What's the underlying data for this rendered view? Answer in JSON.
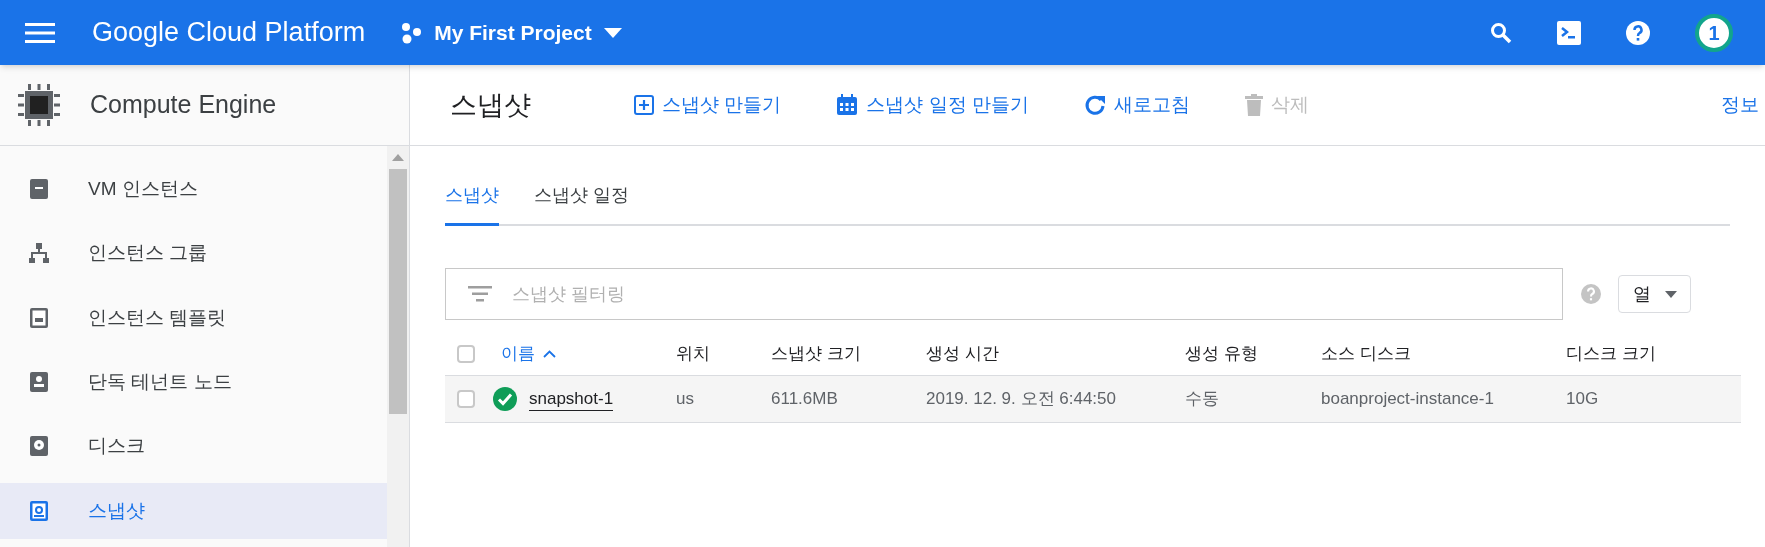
{
  "topbar": {
    "title": "Google Cloud Platform",
    "project": "My First Project",
    "avatar": "1"
  },
  "sidebar": {
    "product": "Compute Engine",
    "items": [
      {
        "label": "VM 인스턴스",
        "kind": "vm",
        "selected": false
      },
      {
        "label": "인스턴스 그룹",
        "kind": "group",
        "selected": false
      },
      {
        "label": "인스턴스 템플릿",
        "kind": "template",
        "selected": false
      },
      {
        "label": "단독 테넌트 노드",
        "kind": "node",
        "selected": false
      },
      {
        "label": "디스크",
        "kind": "disk",
        "selected": false
      },
      {
        "label": "스냅샷",
        "kind": "snapshot",
        "selected": true
      }
    ]
  },
  "page": {
    "title": "스냅샷",
    "actions": [
      {
        "label": "스냅샷 만들기",
        "kind": "create",
        "disabled": false
      },
      {
        "label": "스냅샷 일정 만들기",
        "kind": "schedule",
        "disabled": false
      },
      {
        "label": "새로고침",
        "kind": "refresh",
        "disabled": false
      },
      {
        "label": "삭제",
        "kind": "delete",
        "disabled": true
      }
    ],
    "info": "정보"
  },
  "tabs": [
    {
      "label": "스냅샷",
      "selected": true
    },
    {
      "label": "스냅샷 일정",
      "selected": false
    }
  ],
  "filter": {
    "placeholder": "스냅샷 필터링"
  },
  "columns_button": "열",
  "table": {
    "select_all": {
      "checked": false
    },
    "columns": [
      {
        "label": "이름",
        "sorted": true
      },
      {
        "label": "위치",
        "sorted": false
      },
      {
        "label": "스냅샷 크기",
        "sorted": false
      },
      {
        "label": "생성 시간",
        "sorted": false
      },
      {
        "label": "생성 유형",
        "sorted": false
      },
      {
        "label": "소스 디스크",
        "sorted": false
      },
      {
        "label": "디스크 크기",
        "sorted": false
      }
    ],
    "rows": [
      {
        "checked": false,
        "succeeded": true,
        "cells": [
          "snapshot-1",
          "us",
          "611.6MB",
          "2019. 12. 9. 오전 6:44:50",
          "수동",
          "boanproject-instance-1",
          "10G"
        ]
      }
    ]
  }
}
